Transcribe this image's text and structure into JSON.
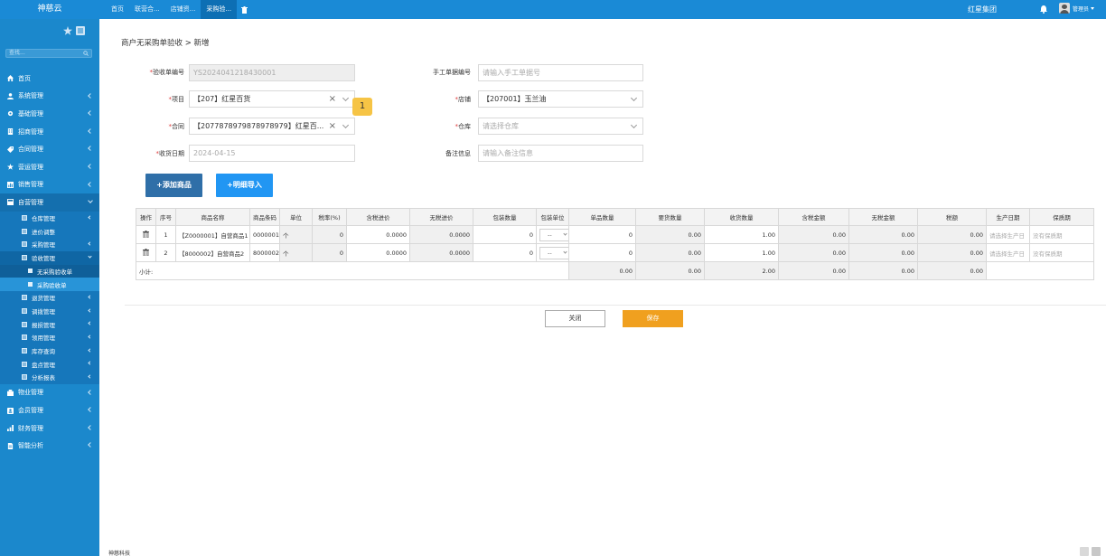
{
  "brand": "神慈云",
  "top_tabs": [
    {
      "label": "首页",
      "active": false
    },
    {
      "label": "联营合...",
      "active": false
    },
    {
      "label": "店铺资...",
      "active": false
    },
    {
      "label": "采购验...",
      "active": true
    }
  ],
  "org_name": "红星集团",
  "user_name": "管理员",
  "sidebar": {
    "search_placeholder": "查找...",
    "menu": [
      {
        "label": "首页",
        "icon": "home-icon"
      },
      {
        "label": "系统管理",
        "icon": "user-icon"
      },
      {
        "label": "基础管理",
        "icon": "gear-icon"
      },
      {
        "label": "招商管理",
        "icon": "building-icon"
      },
      {
        "label": "合同管理",
        "icon": "tag-icon"
      },
      {
        "label": "营运管理",
        "icon": "star-icon"
      },
      {
        "label": "销售管理",
        "icon": "chart-icon"
      },
      {
        "label": "自营管理",
        "icon": "grid-icon"
      }
    ],
    "sub_menu": [
      {
        "label": "仓库管理"
      },
      {
        "label": "进价调整"
      },
      {
        "label": "采购管理"
      },
      {
        "label": "验收管理"
      }
    ],
    "sub2_menu": [
      {
        "label": "无采购验收单"
      },
      {
        "label": "采购验收单"
      }
    ],
    "sub_menu_after": [
      {
        "label": "退货管理"
      },
      {
        "label": "调拨管理"
      },
      {
        "label": "报损管理"
      },
      {
        "label": "领用管理"
      },
      {
        "label": "库存查询"
      },
      {
        "label": "盘点管理"
      },
      {
        "label": "分析报表"
      }
    ],
    "menu_after": [
      {
        "label": "物业管理",
        "icon": "building2-icon"
      },
      {
        "label": "会员管理",
        "icon": "member-icon"
      },
      {
        "label": "财务管理",
        "icon": "finance-icon"
      },
      {
        "label": "智能分析",
        "icon": "doc-icon"
      }
    ]
  },
  "breadcrumb": "商户无采购单验收 > 新增",
  "form": {
    "receipt_no_label": "验收单编号",
    "receipt_no_value": "YS2024041218430001",
    "manual_no_label": "手工单据编号",
    "manual_no_placeholder": "请输入手工单据号",
    "project_label": "项目",
    "project_value": "【207】红星百货",
    "store_label": "店铺",
    "store_value": "【207001】玉兰油",
    "contract_label": "合同",
    "contract_value": "【2077878979878978979】红星百...",
    "warehouse_label": "仓库",
    "warehouse_placeholder": "请选择仓库",
    "date_label": "收货日期",
    "date_value": "2024-04-15",
    "remark_label": "备注信息",
    "remark_placeholder": "请输入备注信息",
    "badge": "1"
  },
  "buttons": {
    "add_goods": "+添加商品",
    "import_detail": "+明细导入",
    "close": "关闭",
    "save": "保存"
  },
  "table": {
    "headers": [
      "操作",
      "序号",
      "商品名称",
      "商品条码",
      "单位",
      "税率(%)",
      "含税进价",
      "无税进价",
      "包装数量",
      "包装单位",
      "单品数量",
      "要货数量",
      "收货数量",
      "含税金额",
      "无税金额",
      "税额",
      "生产日期",
      "保质期"
    ],
    "rows": [
      {
        "seq": "1",
        "name": "【Z0000001】自营商品1",
        "barcode": "0000001",
        "unit": "个",
        "tax": "0",
        "price_tax": "0.0000",
        "price_notax": "0.0000",
        "pkg_qty": "0",
        "pkg_unit": "--",
        "single_qty": "0",
        "req_qty": "0.00",
        "recv_qty": "1.00",
        "amt_tax": "0.00",
        "amt_notax": "0.00",
        "tax_amt": "0.00",
        "prod_date": "请选择生产日",
        "shelf": "没有保质期"
      },
      {
        "seq": "2",
        "name": "【8000002】自营商品2",
        "barcode": "8000002",
        "unit": "个",
        "tax": "0",
        "price_tax": "0.0000",
        "price_notax": "0.0000",
        "pkg_qty": "0",
        "pkg_unit": "--",
        "single_qty": "0",
        "req_qty": "0.00",
        "recv_qty": "1.00",
        "amt_tax": "0.00",
        "amt_notax": "0.00",
        "tax_amt": "0.00",
        "prod_date": "请选择生产日",
        "shelf": "没有保质期"
      }
    ],
    "subtotal": {
      "label": "小计:",
      "single_qty": "0.00",
      "req_qty": "0.00",
      "recv_qty": "2.00",
      "amt_tax": "0.00",
      "amt_notax": "0.00",
      "tax_amt": "0.00"
    }
  },
  "footer_text": "神慈科技"
}
